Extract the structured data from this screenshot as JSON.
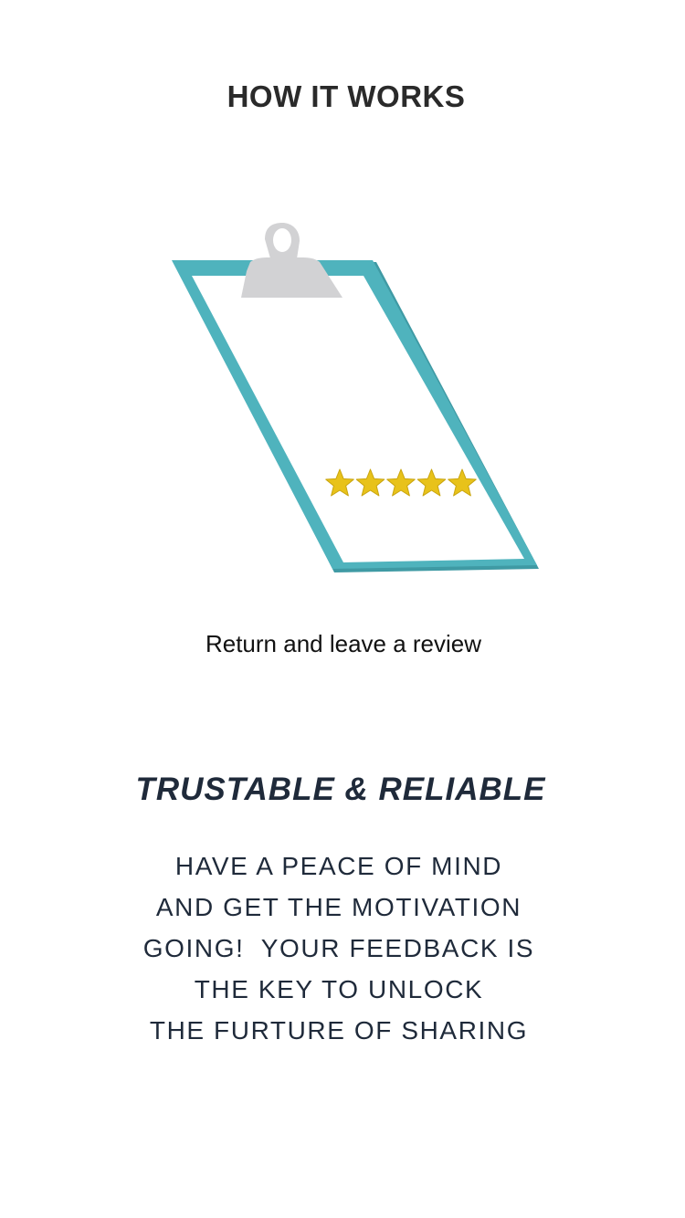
{
  "header": {
    "title": "HOW IT WORKS"
  },
  "step": {
    "illustration_icon": "clipboard-five-star-review",
    "rating_stars": 5,
    "caption": "Return and leave a review"
  },
  "section": {
    "heading": "TRUSTABLE & RELIABLE",
    "body_lines": [
      "HAVE A PEACE OF MIND",
      "AND GET THE MOTIVATION",
      "GOING!  YOUR FEEDBACK IS",
      "THE KEY TO UNLOCK",
      "THE FURTURE OF SHARING"
    ]
  },
  "colors": {
    "clipboard_frame": "#4fb3bd",
    "clipboard_clip": "#d2d2d4",
    "star": "#e8c21a",
    "text_dark": "#1f2a3a"
  }
}
